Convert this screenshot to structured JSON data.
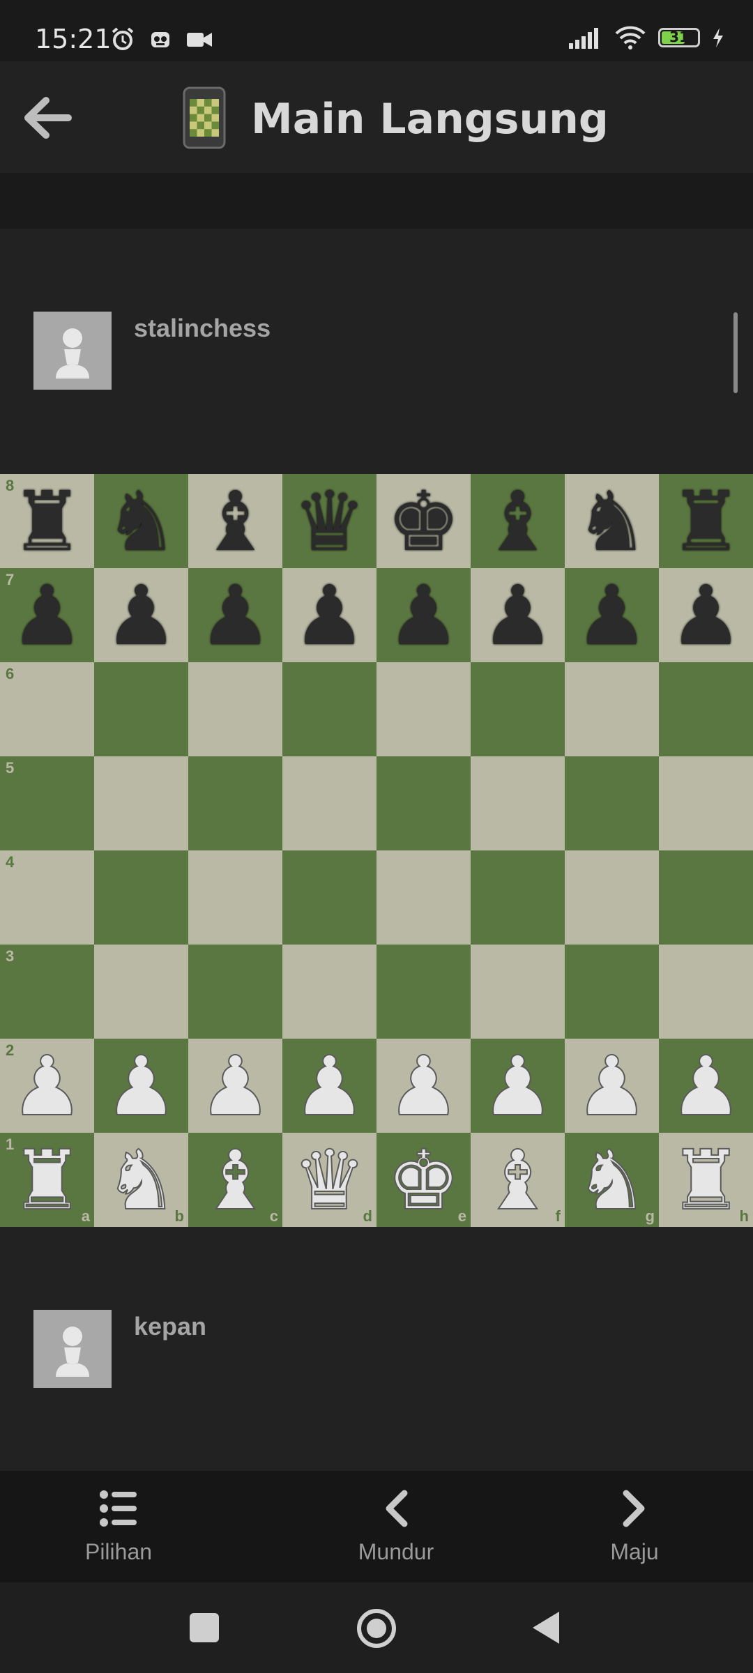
{
  "status_bar": {
    "time": "15:21",
    "battery_level": "31",
    "icons": [
      "alarm-icon",
      "app-notification-icon",
      "video-camera-icon",
      "signal-icon",
      "wifi-icon",
      "battery-icon",
      "charging-icon"
    ]
  },
  "app_bar": {
    "title": "Main Langsung",
    "back_icon": "back-arrow-icon",
    "app_icon": "phone-board-icon"
  },
  "players": {
    "top": {
      "name": "stalinchess"
    },
    "bottom": {
      "name": "kepan"
    }
  },
  "board": {
    "ranks": [
      "8",
      "7",
      "6",
      "5",
      "4",
      "3",
      "2",
      "1"
    ],
    "files": [
      "a",
      "b",
      "c",
      "d",
      "e",
      "f",
      "g",
      "h"
    ],
    "colors": {
      "light": "#b9b9a5",
      "dark": "#5b7741"
    },
    "position": [
      [
        "bR",
        "bN",
        "bB",
        "bQ",
        "bK",
        "bB",
        "bN",
        "bR"
      ],
      [
        "bP",
        "bP",
        "bP",
        "bP",
        "bP",
        "bP",
        "bP",
        "bP"
      ],
      [
        "",
        "",
        "",
        "",
        "",
        "",
        "",
        ""
      ],
      [
        "",
        "",
        "",
        "",
        "",
        "",
        "",
        ""
      ],
      [
        "",
        "",
        "",
        "",
        "",
        "",
        "",
        ""
      ],
      [
        "",
        "",
        "",
        "",
        "",
        "",
        "",
        ""
      ],
      [
        "wP",
        "wP",
        "wP",
        "wP",
        "wP",
        "wP",
        "wP",
        "wP"
      ],
      [
        "wR",
        "wN",
        "wB",
        "wQ",
        "wK",
        "wB",
        "wN",
        "wR"
      ]
    ]
  },
  "bottom_nav": {
    "options": {
      "label": "Pilihan",
      "icon": "list-icon"
    },
    "back": {
      "label": "Mundur",
      "icon": "chevron-left-icon"
    },
    "forward": {
      "label": "Maju",
      "icon": "chevron-right-icon"
    }
  },
  "system_nav": [
    "recents-square-icon",
    "home-circle-icon",
    "back-triangle-icon"
  ]
}
